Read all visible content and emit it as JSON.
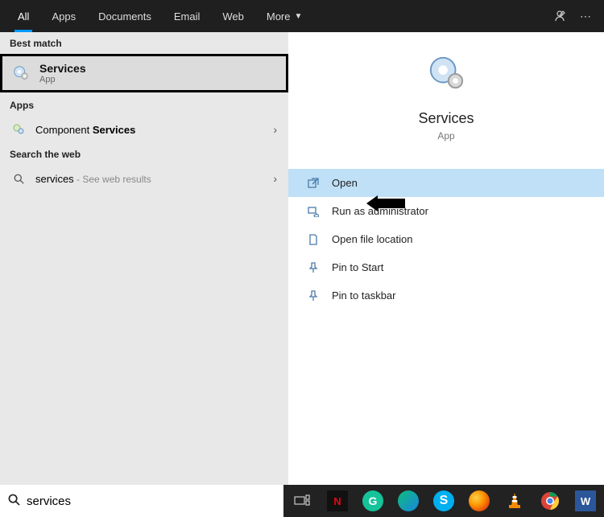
{
  "tabs": {
    "all": "All",
    "apps": "Apps",
    "docs": "Documents",
    "email": "Email",
    "web": "Web",
    "more": "More"
  },
  "left": {
    "best_match_header": "Best match",
    "best_match_title": "Services",
    "best_match_sub": "App",
    "apps_header": "Apps",
    "component_prefix": "Component ",
    "component_bold": "Services",
    "web_header": "Search the web",
    "web_term": "services",
    "web_suffix": " - See web results"
  },
  "preview": {
    "title": "Services",
    "sub": "App"
  },
  "actions": {
    "open": "Open",
    "admin": "Run as administrator",
    "loc": "Open file location",
    "pstart": "Pin to Start",
    "ptask": "Pin to taskbar"
  },
  "search": {
    "value": "services"
  },
  "tray": {
    "netflix": "N",
    "grammarly": "G",
    "word": "W"
  }
}
